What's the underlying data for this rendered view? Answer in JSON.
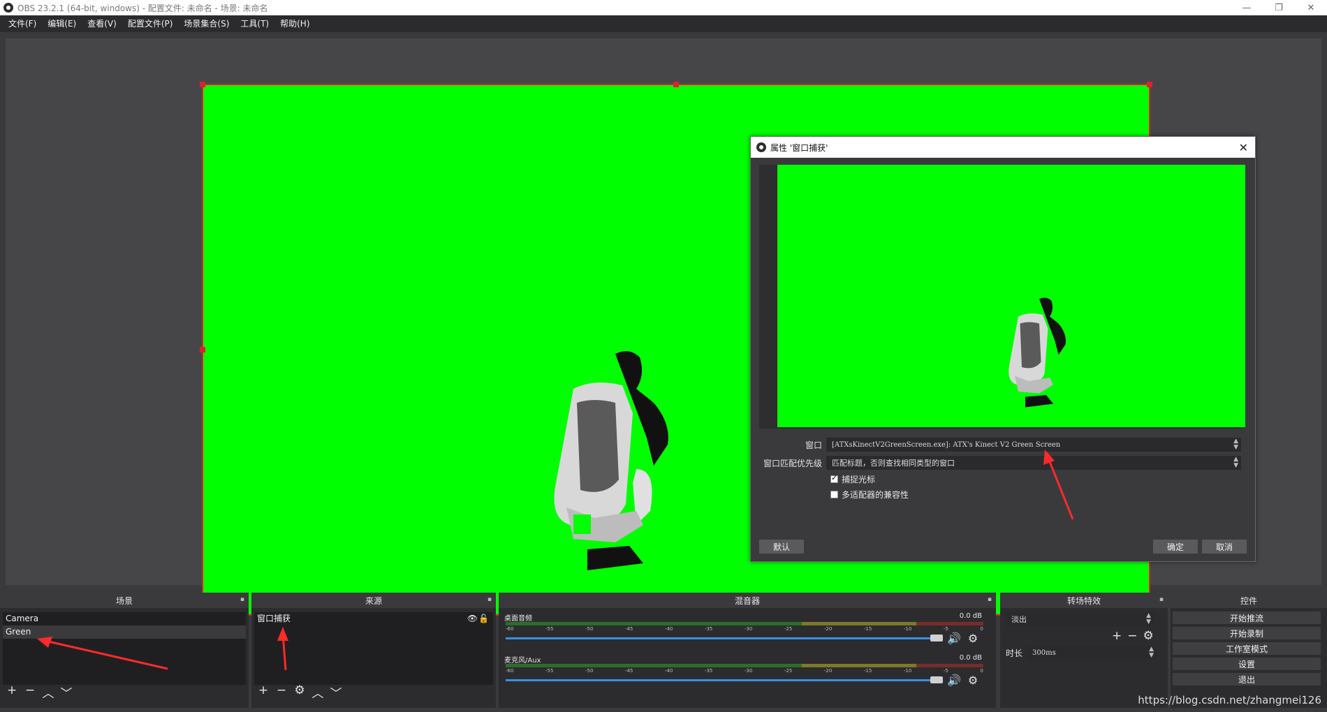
{
  "window": {
    "title": "OBS 23.2.1 (64-bit, windows) - 配置文件: 未命名 - 场景: 未命名",
    "controls": [
      "—",
      "❐",
      "✕"
    ]
  },
  "menu": [
    "文件(F)",
    "编辑(E)",
    "查看(V)",
    "配置文件(P)",
    "场景集合(S)",
    "工具(T)",
    "帮助(H)"
  ],
  "colors": {
    "chroma": "#00ff00",
    "selection": "#e0202a",
    "accent": "#3a8ee6"
  },
  "dialog": {
    "title": "属性 '窗口捕获'",
    "window_label": "窗口",
    "window_value": "[ATXsKinectV2GreenScreen.exe]: ATX's Kinect V2 Green Screen",
    "priority_label": "窗口匹配优先级",
    "priority_value": "匹配标题，否则查找相同类型的窗口",
    "capture_cursor": "捕捉光标",
    "multi_adapter": "多适配器的兼容性",
    "default_btn": "默认",
    "ok_btn": "确定",
    "cancel_btn": "取消"
  },
  "scenes": {
    "title": "场景",
    "items": [
      "Camera",
      "Green"
    ]
  },
  "sources": {
    "title": "来源",
    "items": [
      "窗口捕获"
    ]
  },
  "mixer": {
    "title": "混音器",
    "channels": [
      {
        "name": "桌面音频",
        "db": "0.0 dB"
      },
      {
        "name": "麦克风/Aux",
        "db": "0.0 dB"
      }
    ],
    "scale": [
      "-60",
      "-55",
      "-50",
      "-45",
      "-40",
      "-35",
      "-30",
      "-25",
      "-20",
      "-15",
      "-10",
      "-5",
      "0"
    ]
  },
  "transitions": {
    "title": "转场特效",
    "selected": "淡出",
    "duration_label": "时长",
    "duration_value": "300ms"
  },
  "controls": {
    "title": "控件",
    "buttons": [
      "开始推流",
      "开始录制",
      "工作室模式",
      "设置",
      "退出"
    ]
  },
  "watermark": "https://blog.csdn.net/zhangmei126"
}
